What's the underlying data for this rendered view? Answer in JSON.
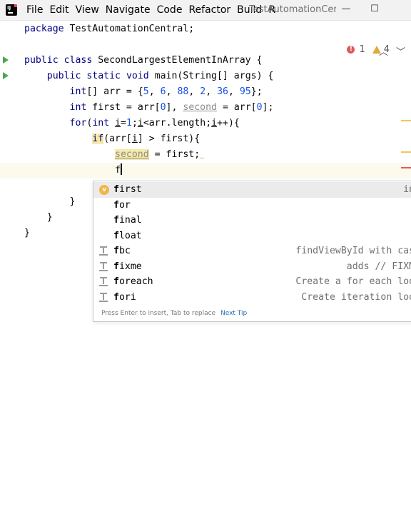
{
  "window": {
    "menu": [
      "File",
      "Edit",
      "View",
      "Navigate",
      "Code",
      "Refactor",
      "Build",
      "R"
    ],
    "project_title": "TestAutomationCentral",
    "controls": {
      "minimize": "—",
      "maximize": "☐"
    }
  },
  "inspections": {
    "errors": "1",
    "warnings": "4"
  },
  "code": {
    "line1": {
      "kw": "package",
      "rest": " TestAutomationCentral;"
    },
    "line3": {
      "kw1": "public",
      "kw2": "class",
      "rest": " SecondLargestElementInArray {"
    },
    "line4": {
      "indent": "    ",
      "kw1": "public",
      "kw2": "static",
      "kw3": "void",
      "rest": " main(String[] args) {"
    },
    "line5": {
      "indent": "        ",
      "kw": "int",
      "a": "[] arr = {",
      "n1": "5",
      "c1": ", ",
      "n2": "6",
      "c2": ", ",
      "n3": "88",
      "c3": ", ",
      "n4": "2",
      "c4": ", ",
      "n5": "36",
      "c5": ", ",
      "n6": "95",
      "end": "};"
    },
    "line6": {
      "indent": "        ",
      "kw": "int",
      "a": " first = arr[",
      "n1": "0",
      "b": "], ",
      "second": "second",
      "c": " = arr[",
      "n2": "0",
      "d": "];"
    },
    "line7": {
      "indent": "        ",
      "kw1": "for",
      "a": "(",
      "kw2": "int",
      "b": " ",
      "i1": "i",
      "c": "=",
      "n1": "1",
      "d": ";",
      "i2": "i",
      "e": "<arr.length;",
      "i3": "i",
      "f": "++){"
    },
    "line8": {
      "indent": "            ",
      "kw": "if",
      "a": "(arr[",
      "i": "i",
      "b": "] > first){"
    },
    "line9": {
      "indent": "                ",
      "second": "second",
      "rest": " = first;"
    },
    "line10": {
      "indent": "                ",
      "typed": "f"
    },
    "line12": {
      "indent": "        ",
      "brace": "}"
    },
    "line14": {
      "indent": "    ",
      "brace": "}"
    },
    "line15": {
      "brace": "}"
    }
  },
  "completion": {
    "items": [
      {
        "bold": "f",
        "rest": "irst",
        "hint": "int",
        "icon": "variable-icon"
      },
      {
        "bold": "f",
        "rest": "or",
        "hint": "",
        "icon": ""
      },
      {
        "bold": "f",
        "rest": "inal",
        "hint": "",
        "icon": ""
      },
      {
        "bold": "f",
        "rest": "loat",
        "hint": "",
        "icon": ""
      },
      {
        "bold": "f",
        "rest": "bc",
        "hint": "findViewById with cast",
        "icon": "live-template-icon"
      },
      {
        "bold": "f",
        "rest": "ixme",
        "hint": "adds // FIXME",
        "icon": "live-template-icon"
      },
      {
        "bold": "f",
        "rest": "oreach",
        "hint": "Create a for each loop",
        "icon": "live-template-icon"
      },
      {
        "bold": "f",
        "rest": "ori",
        "hint": "Create iteration loop",
        "icon": "live-template-icon"
      }
    ],
    "footer_text": "Press Enter to insert, Tab to replace",
    "footer_link": "Next Tip"
  },
  "colors": {
    "keyword": "#0033b3",
    "number": "#1750eb",
    "unused": "#8c8c8c",
    "selected_row": "#ebebeb",
    "run_gutter": "#4ca74c",
    "warning_mark": "#f2c55c",
    "error_mark": "#e55757"
  }
}
